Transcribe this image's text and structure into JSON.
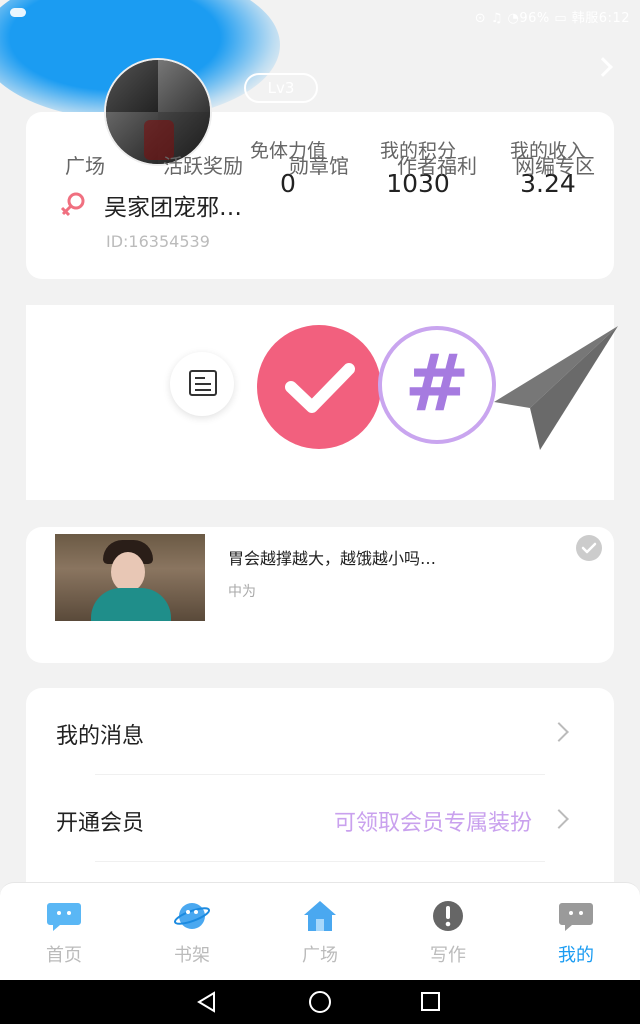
{
  "status_bar": {
    "right": "⊙ ♫ ◔96% ▭ 韩服6:12"
  },
  "header": {
    "level": "Lv3"
  },
  "profile": {
    "username": "吴家团宠邪…",
    "user_id": "ID:16354539",
    "stats": [
      {
        "label": "免体力值",
        "value": "0"
      },
      {
        "label": "我的积分",
        "value": "1030"
      },
      {
        "label": "我的收入",
        "value": "3.24"
      }
    ]
  },
  "quick_menu": [
    {
      "label": "广场"
    },
    {
      "label": "活跃奖励"
    },
    {
      "label": "勋章馆"
    },
    {
      "label": "作者福利"
    },
    {
      "label": "网编专区"
    }
  ],
  "article": {
    "title": "胃会越撑越大，越饿越小吗…",
    "author": "中为"
  },
  "settings": [
    {
      "label": "我的消息",
      "hint": ""
    },
    {
      "label": "开通会员",
      "hint": "可领取会员专属装扮"
    }
  ],
  "tabs": [
    {
      "label": "首页",
      "icon": "chat-bubble-icon"
    },
    {
      "label": "书架",
      "icon": "planet-icon"
    },
    {
      "label": "广场",
      "icon": "home-icon"
    },
    {
      "label": "写作",
      "icon": "exclamation-icon"
    },
    {
      "label": "我的",
      "icon": "chat-face-icon",
      "active": true
    }
  ],
  "colors": {
    "accent": "#1b9cf2",
    "pink": "#f2607e",
    "purple": "#c9a1ee"
  }
}
